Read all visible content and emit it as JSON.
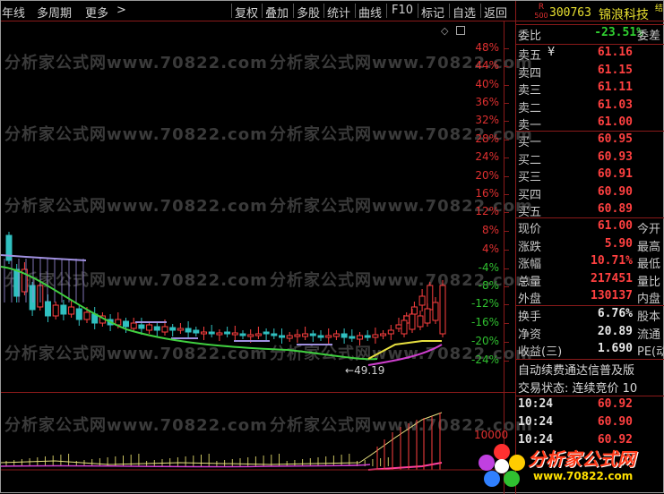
{
  "toolbar": {
    "left_items": [
      "年线",
      "多周期",
      "更多",
      ">"
    ],
    "buttons": [
      "复权",
      "叠加",
      "多股",
      "统计",
      "曲线",
      "F10",
      "标记",
      "自选",
      "返回"
    ]
  },
  "chart": {
    "pct_labels": [
      "48%",
      "44%",
      "40%",
      "36%",
      "32%",
      "28%",
      "24%",
      "20%",
      "16%",
      "12%",
      "8%",
      "4%",
      "-4%",
      "-8%",
      "-12%",
      "-16%",
      "-20%",
      "-24%"
    ],
    "low_annotation": "49.19",
    "volume_label": "10000",
    "watermark": "分析家公式网www.70822.com"
  },
  "quote": {
    "badge_top": "R",
    "badge_bottom": "500",
    "code": "300763",
    "name": "锦浪科技",
    "corner_mark": "结",
    "weibi_label": "委比",
    "weibi_value": "-23.51%",
    "weicha_label": "委差",
    "sells": [
      {
        "label": "卖五",
        "mark": "¥",
        "price": "61.16"
      },
      {
        "label": "卖四",
        "price": "61.15"
      },
      {
        "label": "卖三",
        "price": "61.11"
      },
      {
        "label": "卖二",
        "price": "61.03"
      },
      {
        "label": "卖一",
        "price": "61.00"
      }
    ],
    "buys": [
      {
        "label": "买一",
        "price": "60.95"
      },
      {
        "label": "买二",
        "price": "60.93"
      },
      {
        "label": "买三",
        "price": "60.91"
      },
      {
        "label": "买四",
        "price": "60.90"
      },
      {
        "label": "买五",
        "price": "60.89"
      }
    ],
    "stats": [
      {
        "label": "现价",
        "value": "61.00",
        "right": "今开"
      },
      {
        "label": "涨跌",
        "value": "5.90",
        "right": "最高"
      },
      {
        "label": "涨幅",
        "value": "10.71%",
        "right": "最低"
      },
      {
        "label": "总量",
        "value": "217451",
        "right": "量比"
      },
      {
        "label": "外盘",
        "value": "130137",
        "right": "内盘"
      }
    ],
    "stats2": [
      {
        "label": "换手",
        "value": "6.76%",
        "right": "股本"
      },
      {
        "label": "净资",
        "value": "20.89",
        "right": "流通"
      },
      {
        "label": "收益(三)",
        "value": "1.690",
        "right": "PE(动"
      }
    ],
    "auto_renew": "自动续费通达信普及版",
    "trade_status": "交易状态: 连续竞价 10",
    "ticks": [
      {
        "time": "10:24",
        "price": "60.92"
      },
      {
        "time": "10:24",
        "price": "60.90"
      },
      {
        "time": "10:24",
        "price": "60.92"
      }
    ]
  },
  "logo": {
    "title": "分析家公式网",
    "url": "www.70822.com"
  },
  "colors": {
    "up": "#ff4040",
    "down": "#30c0c0",
    "ma_green": "#40d040",
    "ma_yellow": "#e8e040",
    "ma_magenta": "#d040d0",
    "ma_lavender": "#a090e0",
    "grid_red": "#8a1a1a"
  }
}
